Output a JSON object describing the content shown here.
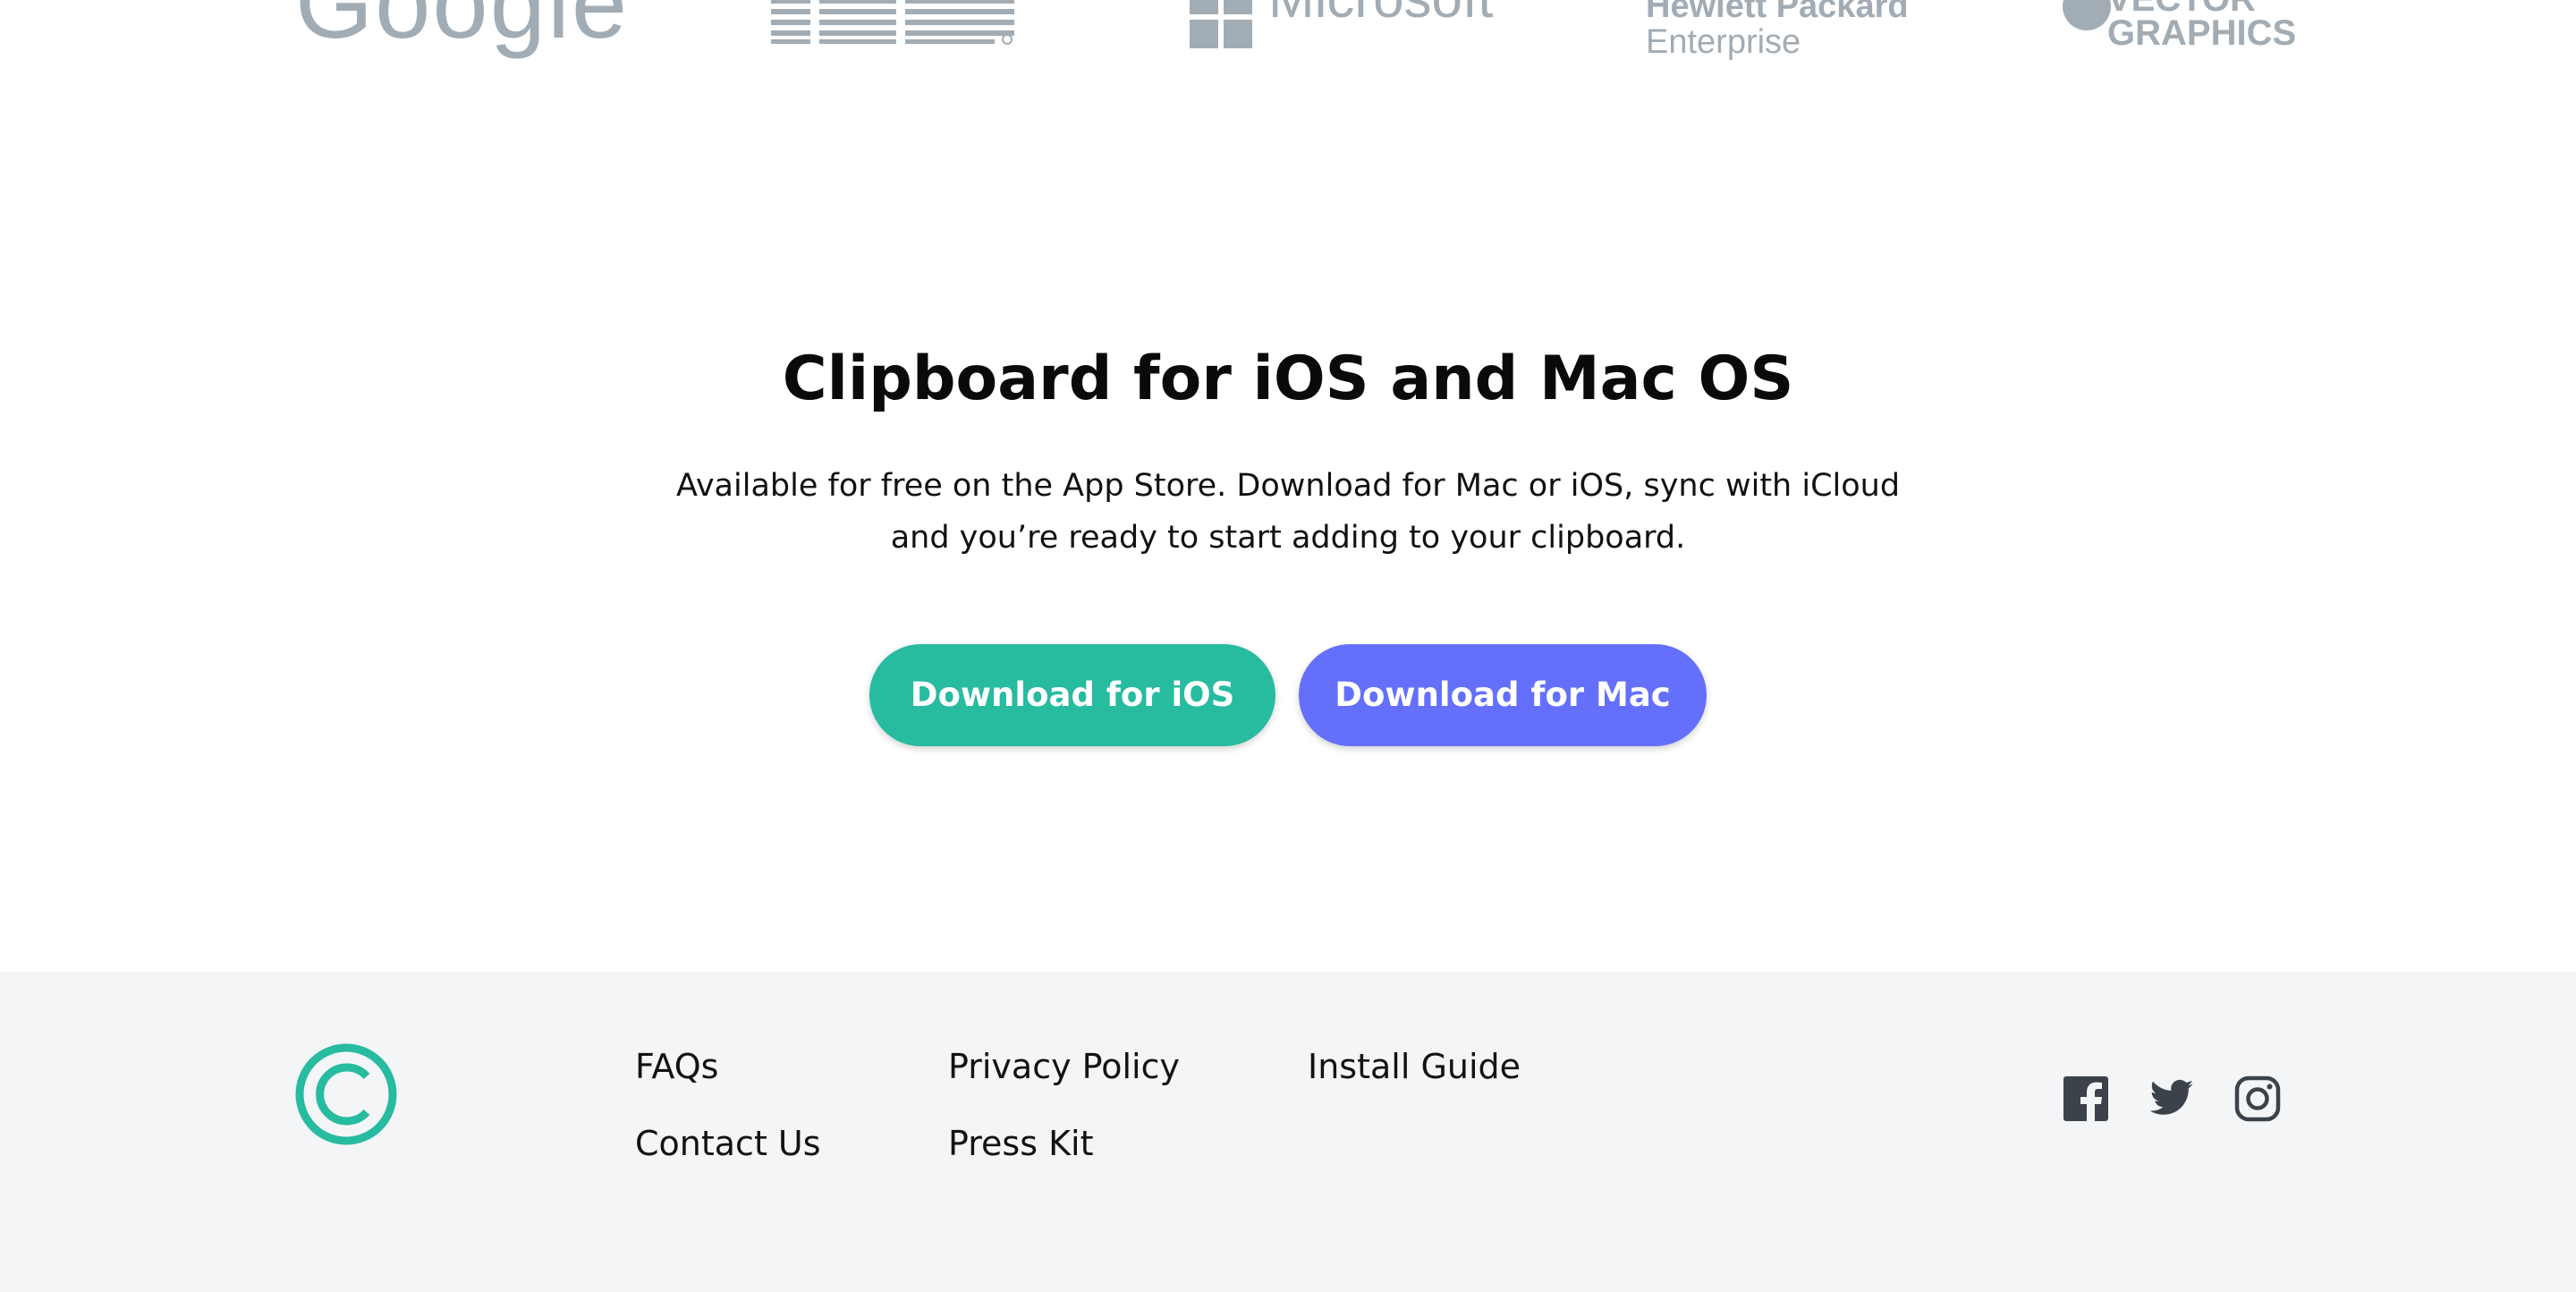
{
  "logos": {
    "google": "Google",
    "ibm": "IBM",
    "microsoft": "Microsoft",
    "hpe_line1": "Hewlett Packard",
    "hpe_line2": "Enterprise",
    "vector_line1": "VECTOR",
    "vector_line2": "GRAPHICS"
  },
  "cta": {
    "title": "Clipboard for iOS and Mac OS",
    "description": "Available for free on the App Store. Download for Mac or iOS, sync with iCloud and you’re ready to start adding to your clipboard.",
    "ios_button": "Download for iOS",
    "mac_button": "Download for Mac"
  },
  "footer": {
    "links": {
      "faqs": "FAQs",
      "contact": "Contact Us",
      "privacy": "Privacy Policy",
      "press": "Press Kit",
      "install": "Install Guide"
    },
    "social": [
      "facebook-icon",
      "twitter-icon",
      "instagram-icon"
    ]
  },
  "colors": {
    "accent_teal": "#27bba0",
    "accent_blue": "#6470fb",
    "logo_gray": "#a2acb4",
    "footer_bg": "#f4f5f7",
    "icon_dark": "#3b424a"
  }
}
